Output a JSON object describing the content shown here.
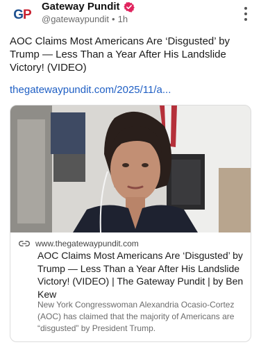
{
  "author": {
    "display_name": "Gateway Pundit",
    "handle": "@gatewaypundit",
    "separator": "•",
    "time": "1h",
    "avatar_initials_first": "G",
    "avatar_initials_second": "P",
    "verified_color": "#e0245e"
  },
  "post": {
    "text": "AOC Claims Most Americans Are ‘Disgusted’ by Trump — Less Than a Year After His Landslide Victory! (VIDEO)",
    "link_text": "thegatewaypundit.com/2025/11/a..."
  },
  "card": {
    "domain": "www.thegatewaypundit.com",
    "title": "AOC Claims Most Americans Are ‘Disgusted’ by Trump — Less Than a Year After His Landslide Victory! (VIDEO) | The Gateway Pundit | by Ben Kew",
    "description": "New York Congresswoman Alexandria Ocasio-Cortez (AOC) has claimed that the majority of Americans are “disgusted” by President Trump."
  },
  "colors": {
    "link": "#1f5fc4",
    "secondary_text": "#6b6b6b"
  },
  "icons": {
    "more": "more-vertical-icon",
    "verified": "verified-badge-icon",
    "link": "link-icon"
  }
}
